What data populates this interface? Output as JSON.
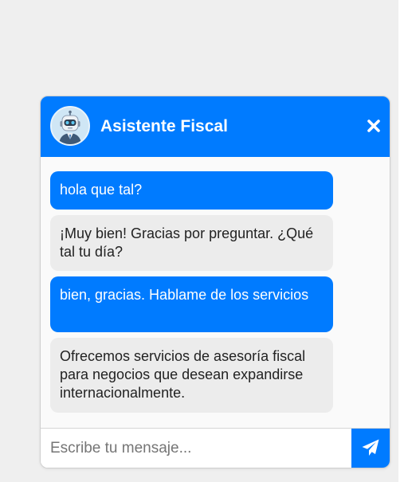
{
  "header": {
    "title": "Asistente Fiscal",
    "avatar_icon": "robot-avatar-icon",
    "close_icon": "close-icon"
  },
  "messages": [
    {
      "role": "user",
      "text": "hola que tal?"
    },
    {
      "role": "bot",
      "text": "¡Muy bien! Gracias por preguntar. ¿Qué tal tu día?"
    },
    {
      "role": "user",
      "text": "bien, gracias. Hablame de los servicios"
    },
    {
      "role": "bot",
      "text": "Ofrecemos servicios de asesoría fiscal para negocios que desean expandirse internacionalmente."
    }
  ],
  "input": {
    "placeholder": "Escribe tu mensaje...",
    "value": "",
    "send_icon": "paper-plane-icon"
  },
  "colors": {
    "accent": "#007bff",
    "bot_bubble": "#ececec",
    "page_background": "#efefef"
  }
}
